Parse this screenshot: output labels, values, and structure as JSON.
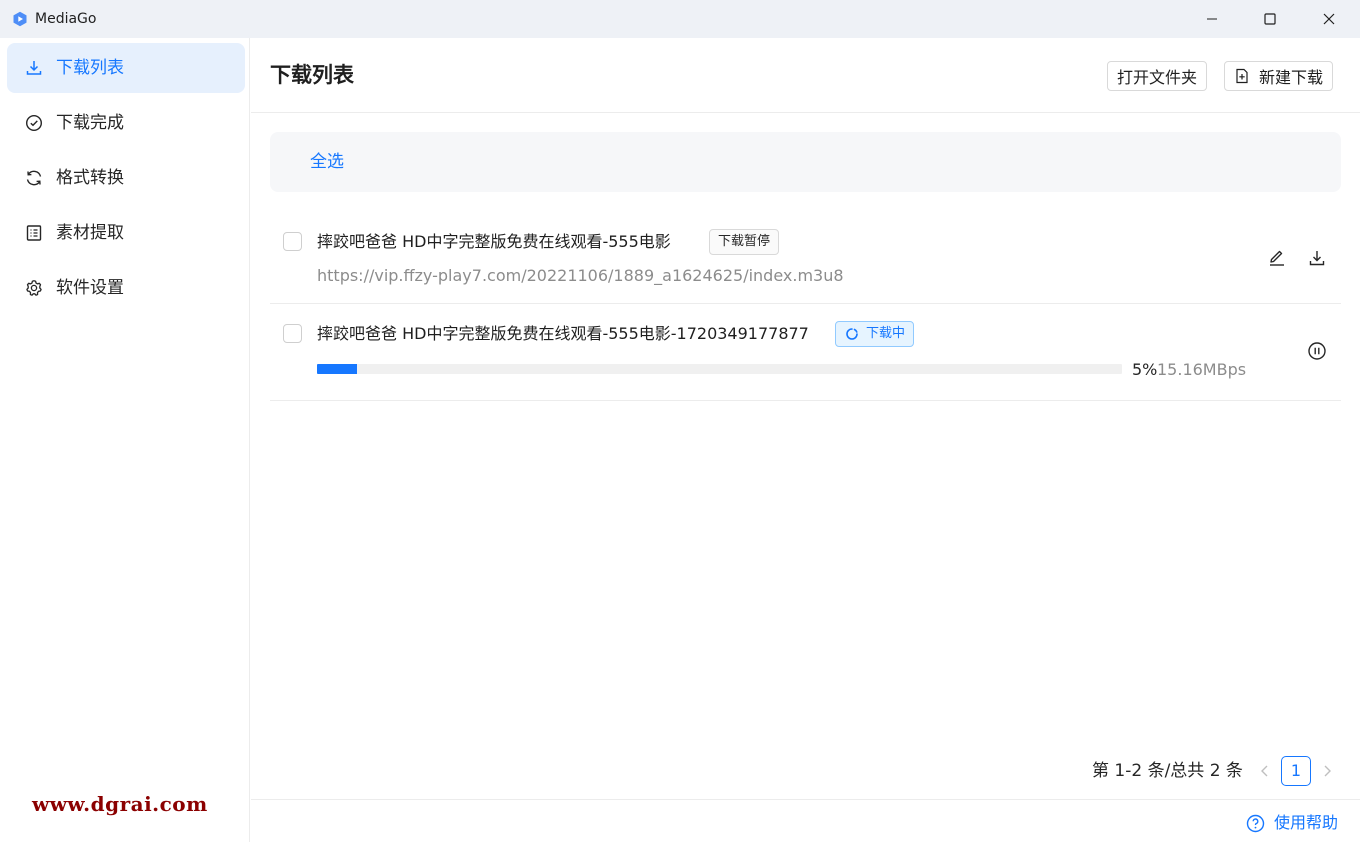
{
  "app": {
    "title": "MediaGo",
    "accent": "#1677ff"
  },
  "sidebar": {
    "items": [
      {
        "label": "下载列表",
        "icon": "download-icon",
        "active": true
      },
      {
        "label": "下载完成",
        "icon": "check-circle-icon",
        "active": false
      },
      {
        "label": "格式转换",
        "icon": "sync-icon",
        "active": false
      },
      {
        "label": "素材提取",
        "icon": "document-list-icon",
        "active": false
      },
      {
        "label": "软件设置",
        "icon": "gear-icon",
        "active": false
      }
    ],
    "watermark": "www.dgrai.com"
  },
  "header": {
    "title": "下载列表",
    "open_folder_label": "打开文件夹",
    "new_download_label": "新建下载"
  },
  "toolbar": {
    "select_all_label": "全选"
  },
  "downloads": [
    {
      "title": "摔跤吧爸爸 HD中字完整版免费在线观看-555电影",
      "status": "下载暂停",
      "url": "https://vip.ffzy-play7.com/20221106/1889_a1624625/index.m3u8"
    },
    {
      "title": "摔跤吧爸爸 HD中字完整版免费在线观看-555电影-1720349177877",
      "status": "下载中",
      "progress_percent": 5,
      "progress_label": "5%",
      "speed": "15.16MBps"
    }
  ],
  "pagination": {
    "total_text": "第 1-2 条/总共 2 条",
    "current_page": "1"
  },
  "footer": {
    "help_label": "使用帮助"
  }
}
